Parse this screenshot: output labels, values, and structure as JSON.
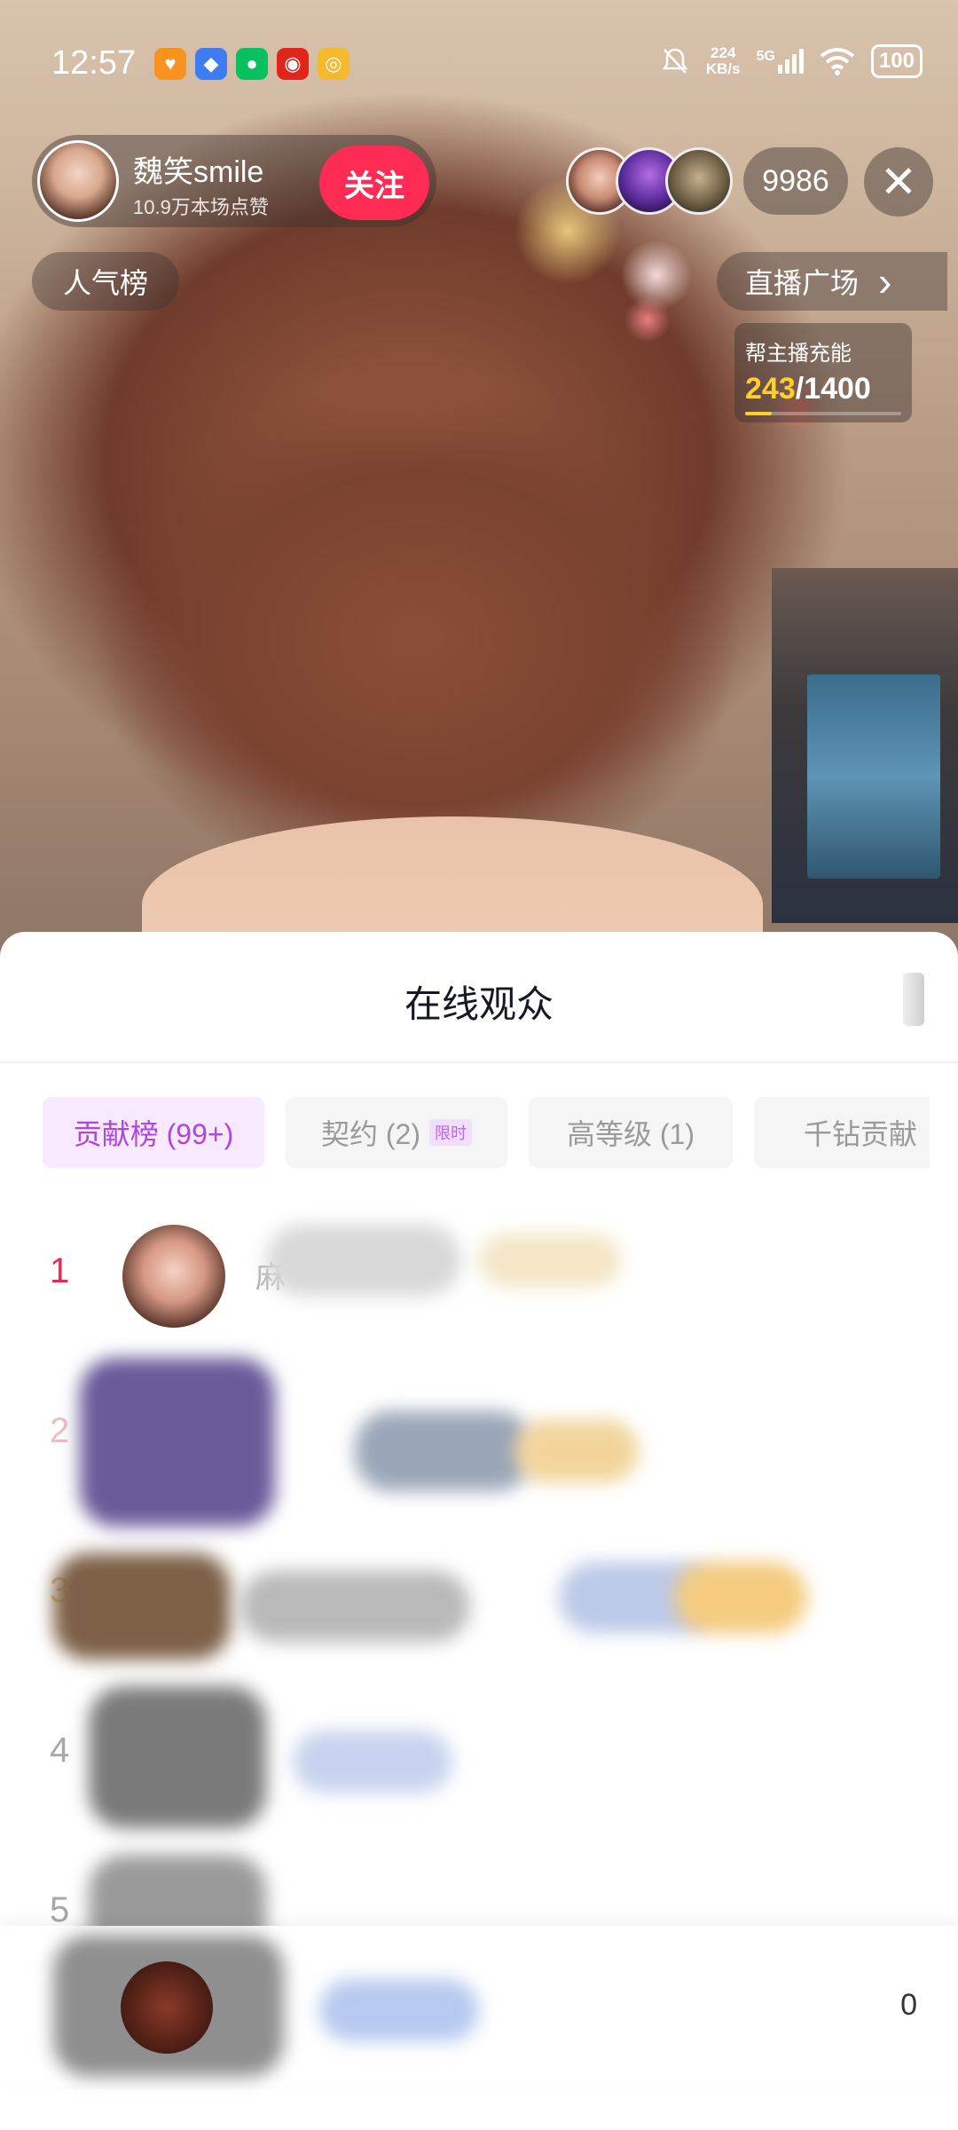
{
  "status_bar": {
    "time": "12:57",
    "network_speed_top": "224",
    "network_speed_unit": "KB/s",
    "signal": "5G",
    "battery": "100"
  },
  "live": {
    "host_name": "魏笑smile",
    "host_likes": "10.9万本场点赞",
    "follow_label": "关注",
    "viewer_count": "9986",
    "close_label": "✕",
    "popularity_rank_label": "人气榜",
    "plaza_label": "直播广场",
    "plaza_arrow": "›",
    "charge": {
      "title": "帮主播充能",
      "current": "243",
      "separator": "/",
      "total": "1400",
      "progress_fraction": 0.17
    }
  },
  "sheet": {
    "title": "在线观众",
    "tabs": [
      {
        "label": "贡献榜 (99+)",
        "active": true
      },
      {
        "label": "契约 (2)",
        "badge": "限时",
        "active": false
      },
      {
        "label": "高等级 (1)",
        "active": false
      },
      {
        "label": "千钻贡献",
        "active": false
      }
    ],
    "rows": [
      {
        "rank": "1",
        "name": "麻"
      },
      {
        "rank": "2",
        "name": ""
      },
      {
        "rank": "3",
        "name": ""
      },
      {
        "rank": "4",
        "name": ""
      },
      {
        "rank": "5",
        "name": ""
      }
    ],
    "me_score": "0"
  },
  "colors": {
    "follow": "#fe2c55",
    "rank_first": "#e02e55",
    "active_tab_text": "#b045e0",
    "active_tab_bg": "#f7eaff",
    "charge_highlight": "#ffcf2f"
  },
  "icons": [
    "bell-muted-icon",
    "wifi-icon",
    "signal-icon",
    "close-icon",
    "chevron-right-icon"
  ]
}
